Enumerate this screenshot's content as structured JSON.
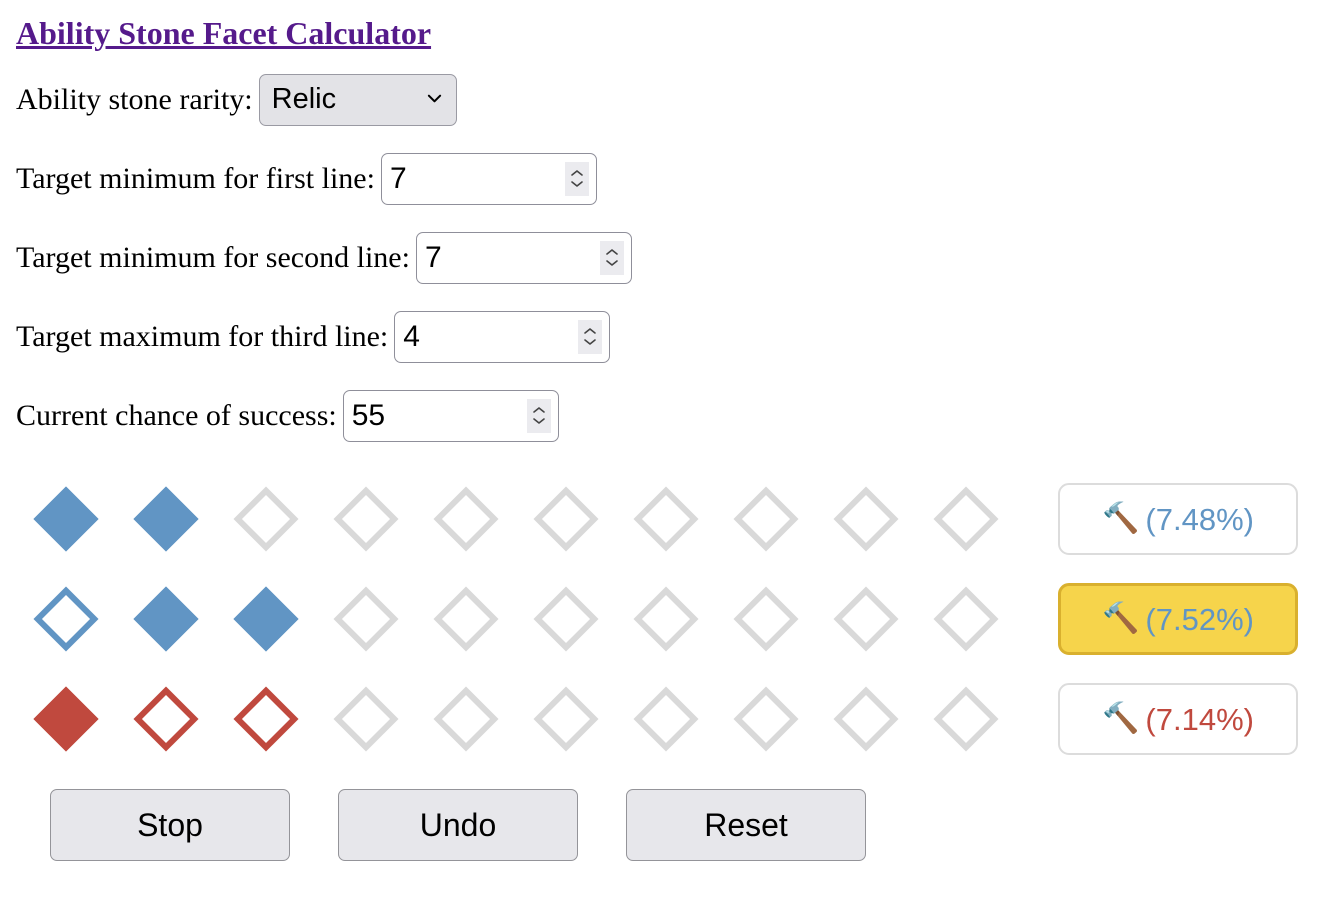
{
  "page": {
    "title": "Ability Stone Facet Calculator"
  },
  "form": {
    "rarity": {
      "label": "Ability stone rarity:",
      "value": "Relic",
      "options": [
        "Relic"
      ],
      "icon": "chevron-down-icon"
    },
    "first_line": {
      "label": "Target minimum for first line:",
      "value": "7"
    },
    "second_line": {
      "label": "Target minimum for second line:",
      "value": "7"
    },
    "third_line": {
      "label": "Target maximum for third line:",
      "value": "4"
    },
    "chance": {
      "label": "Current chance of success:",
      "value": "55"
    }
  },
  "facets": {
    "columns": 10,
    "colors": {
      "blue": "#6195C4",
      "red": "#C0493E",
      "empty": "#D9D9D9",
      "highlight": "#F6D44B",
      "highlight_border": "#D9B02E"
    },
    "rows": [
      {
        "name": "first-line",
        "states": [
          "blue-filled",
          "blue-filled",
          "empty",
          "empty",
          "empty",
          "empty",
          "empty",
          "empty",
          "empty",
          "empty"
        ],
        "button": {
          "icon": "hammer-icon",
          "icon_glyph": "🔨",
          "label": "(7.48%)",
          "color": "blue",
          "highlighted": false
        }
      },
      {
        "name": "second-line",
        "states": [
          "blue-outline",
          "blue-filled",
          "blue-filled",
          "empty",
          "empty",
          "empty",
          "empty",
          "empty",
          "empty",
          "empty"
        ],
        "button": {
          "icon": "hammer-icon",
          "icon_glyph": "🔨",
          "label": "(7.52%)",
          "color": "blue",
          "highlighted": true
        }
      },
      {
        "name": "third-line",
        "states": [
          "red-filled",
          "red-outline",
          "red-outline",
          "empty",
          "empty",
          "empty",
          "empty",
          "empty",
          "empty",
          "empty"
        ],
        "button": {
          "icon": "hammer-icon",
          "icon_glyph": "🔨",
          "label": "(7.14%)",
          "color": "red",
          "highlighted": false
        }
      }
    ]
  },
  "actions": [
    {
      "name": "stop-button",
      "label": "Stop"
    },
    {
      "name": "undo-button",
      "label": "Undo"
    },
    {
      "name": "reset-button",
      "label": "Reset"
    }
  ]
}
